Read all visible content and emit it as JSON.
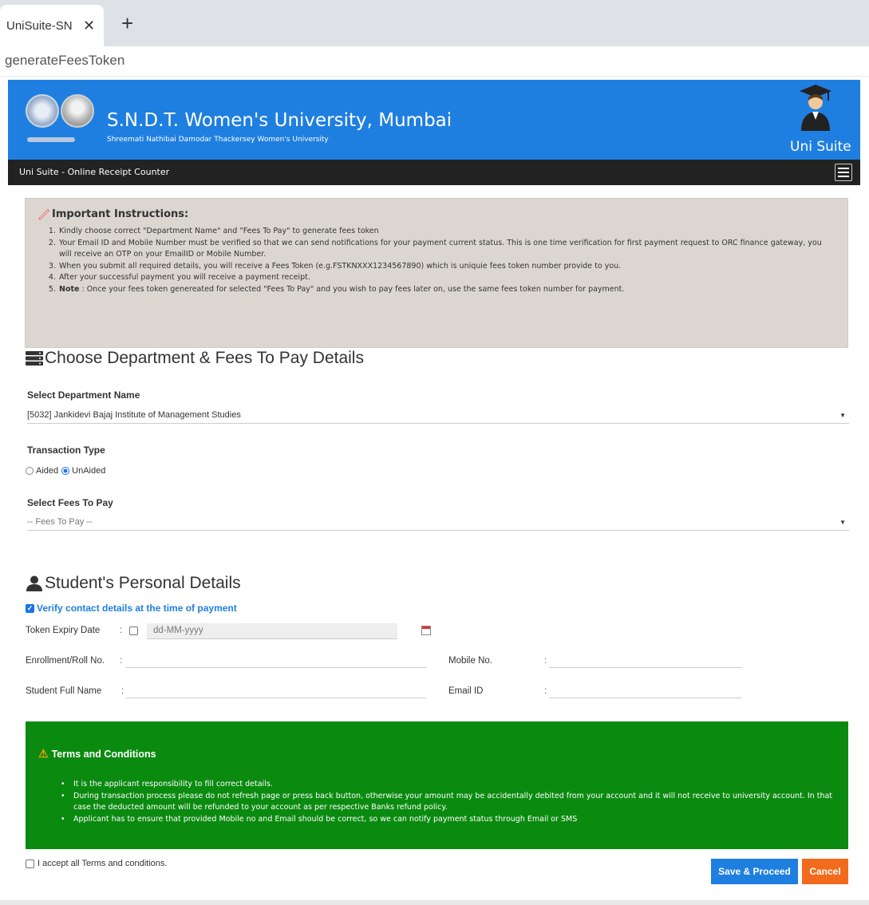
{
  "browser": {
    "tab_title": "UniSuite-SN",
    "address": "generateFeesToken"
  },
  "header": {
    "university_name": "S.N.D.T. Women's University, Mumbai",
    "university_subtitle": "Shreemati Nathibai Damodar Thackersey Women's University",
    "brand": "Uni Suite",
    "nav_title": "Uni Suite - Online Receipt Counter",
    "colors": {
      "header_bg": "#1f7fe0",
      "nav_bg": "#222222"
    }
  },
  "instructions": {
    "title": "Important Instructions:",
    "items": [
      {
        "num": "1.",
        "text": "Kindly choose correct \"Department Name\" and \"Fees To Pay\" to generate fees token"
      },
      {
        "num": "2.",
        "text": "Your Email ID and Mobile Number must be verified so that we can send notifications for your payment current status. This is one time verification for first payment request to ORC finance gateway, you will receive an OTP on your EmailID or Mobile Number."
      },
      {
        "num": "3.",
        "text": "When you submit all required details, you will receive a Fees Token (e.g.FSTKNXXX1234567890) which is uniquie fees token number provide to you."
      },
      {
        "num": "4.",
        "text": "After your successful payment you will receive a payment receipt."
      },
      {
        "num": "5.",
        "note": "Note",
        "text": " : Once your fees token genereated for selected \"Fees To Pay\" and you wish to pay fees later on, use the same fees token number for payment."
      }
    ]
  },
  "department_section": {
    "heading": "Choose Department & Fees To Pay Details",
    "department_label": "Select Department Name",
    "department_value": "[5032] Jankidevi Bajaj Institute of Management Studies",
    "transaction_type_label": "Transaction Type",
    "transaction_options": [
      "Aided",
      "UnAided"
    ],
    "transaction_selected": "UnAided",
    "fees_label": "Select Fees To Pay",
    "fees_value": "-- Fees To Pay --"
  },
  "personal_section": {
    "heading": "Student's Personal Details",
    "verify_label": "Verify contact details at the time of payment",
    "token_expiry_label": "Token Expiry Date",
    "token_expiry_placeholder": "dd-MM-yyyy",
    "enrollment_label": "Enrollment/Roll No.",
    "mobile_label": "Mobile No.",
    "full_name_label": "Student Full Name",
    "email_label": "Email ID",
    "colon": ":"
  },
  "terms": {
    "title": "Terms and Conditions",
    "items": [
      "It is the applicant responsibility to fill correct details.",
      "During transaction process please do not refresh page or press back button, otherwise your amount may be accidentally debited from your account and it will not receive to university account. In that case the deducted amount will be refunded to your account as per respective Banks refund policy.",
      "Applicant has to ensure that provided Mobile no and Email should be correct, so we can notify payment status through Email or SMS"
    ],
    "colors": {
      "bg": "#0b8a10"
    }
  },
  "footer": {
    "accept_label": "I accept all Terms and conditions.",
    "save_label": "Save & Proceed",
    "cancel_label": "Cancel",
    "colors": {
      "save": "#1f7fe0",
      "cancel": "#f26b1d"
    }
  }
}
